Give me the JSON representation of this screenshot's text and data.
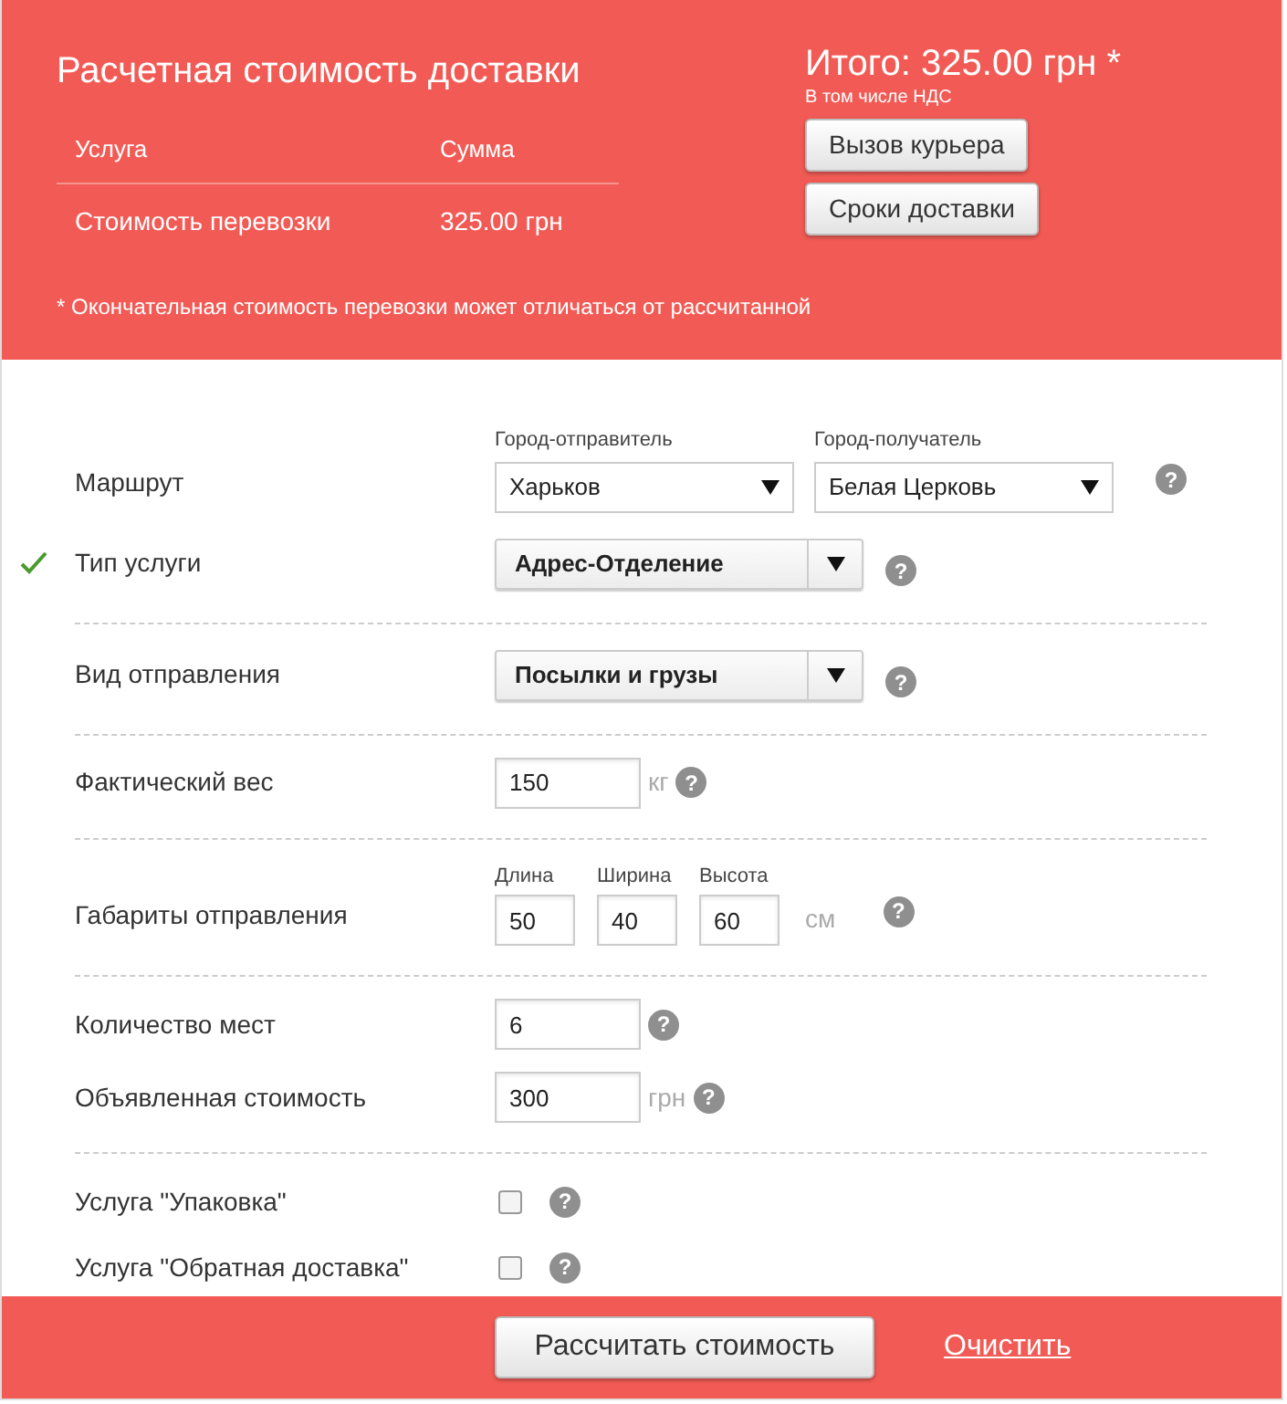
{
  "summary": {
    "title": "Расчетная стоимость доставки",
    "table": {
      "columns": [
        "Услуга",
        "Сумма"
      ],
      "rows": [
        [
          "Стоимость перевозки",
          "325.00 грн"
        ]
      ]
    },
    "total": "Итого: 325.00 грн *",
    "total_note": "В том числе НДС",
    "buttons": [
      "Вызов курьера",
      "Сроки доставки"
    ],
    "footnote": "* Окончательная стоимость перевозки может отличаться от рассчитанной"
  },
  "form": {
    "sections": [
      [
        {
          "kind": "route",
          "label": "Маршрут",
          "valid": false,
          "help": "?",
          "fields": [
            {
              "label": "Город-отправитель",
              "value": "Харьков"
            },
            {
              "label": "Город-получатель",
              "value": "Белая Церковь"
            }
          ]
        },
        {
          "kind": "select",
          "label": "Тип услуги",
          "valid": true,
          "help": "?",
          "value": "Адрес-Отделение"
        }
      ],
      [
        {
          "kind": "select",
          "label": "Вид отправления",
          "valid": false,
          "help": "?",
          "value": "Посылки и грузы"
        }
      ],
      [
        {
          "kind": "input",
          "label": "Фактический вес",
          "valid": false,
          "help": "?",
          "value": "150",
          "unit": "кг"
        }
      ],
      [
        {
          "kind": "dimensions",
          "label": "Габариты отправления",
          "valid": false,
          "help": "?",
          "unit": "см",
          "fields": [
            {
              "label": "Длина",
              "value": "50"
            },
            {
              "label": "Ширина",
              "value": "40"
            },
            {
              "label": "Высота",
              "value": "60"
            }
          ]
        }
      ],
      [
        {
          "kind": "input",
          "label": "Количество мест",
          "valid": false,
          "help": "?",
          "value": "6"
        },
        {
          "kind": "input",
          "label": "Объявленная стоимость",
          "valid": false,
          "help": "?",
          "value": "300",
          "unit": "грн"
        }
      ],
      [
        {
          "kind": "checkbox",
          "label": "Услуга \"Упаковка\"",
          "valid": false,
          "help": "?",
          "checked": false
        },
        {
          "kind": "checkbox",
          "label": "Услуга \"Обратная доставка\"",
          "valid": false,
          "help": "?",
          "checked": false
        }
      ]
    ]
  },
  "actions": {
    "calculate": "Рассчитать стоимость",
    "clear": "Очистить"
  }
}
